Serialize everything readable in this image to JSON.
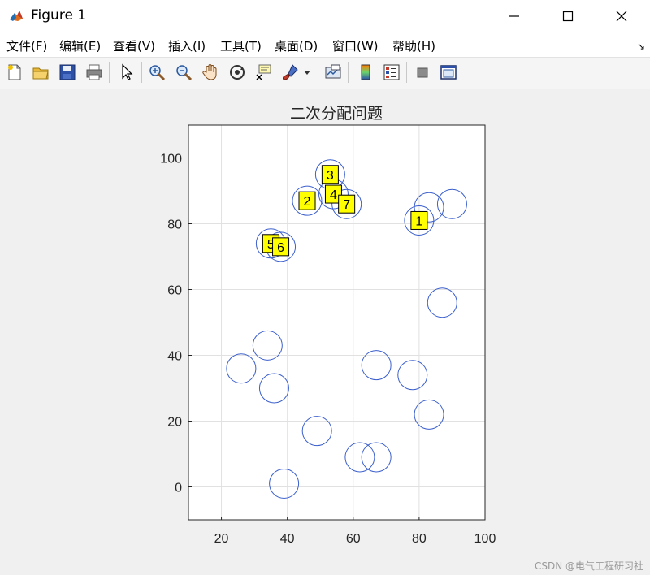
{
  "window": {
    "title": "Figure 1"
  },
  "menu": [
    "文件(F)",
    "编辑(E)",
    "查看(V)",
    "插入(I)",
    "工具(T)",
    "桌面(D)",
    "窗口(W)",
    "帮助(H)"
  ],
  "toolbar_icons": [
    "new-figure-icon",
    "open-file-icon",
    "save-icon",
    "print-icon",
    "pointer-icon",
    "zoom-in-icon",
    "zoom-out-icon",
    "pan-icon",
    "rotate-3d-icon",
    "data-cursor-icon",
    "brush-icon",
    "dropdown-arrow-icon",
    "link-plot-icon",
    "colorbar-icon",
    "legend-icon",
    "hide-plot-tools-icon",
    "show-plot-tools-icon"
  ],
  "chart_data": {
    "type": "scatter",
    "title": "二次分配问题",
    "xlim": [
      10,
      100
    ],
    "ylim": [
      -10,
      110
    ],
    "xticks": [
      20,
      40,
      60,
      80,
      100
    ],
    "yticks": [
      0,
      20,
      40,
      60,
      80,
      100
    ],
    "grid": true,
    "marker": "circle",
    "marker_color": "#3b5fcc",
    "circles": [
      {
        "x": 53,
        "y": 95
      },
      {
        "x": 46,
        "y": 87
      },
      {
        "x": 54,
        "y": 89
      },
      {
        "x": 58,
        "y": 86
      },
      {
        "x": 35,
        "y": 74
      },
      {
        "x": 38,
        "y": 73
      },
      {
        "x": 80,
        "y": 81
      },
      {
        "x": 83,
        "y": 85
      },
      {
        "x": 90,
        "y": 86
      },
      {
        "x": 87,
        "y": 56
      },
      {
        "x": 34,
        "y": 43
      },
      {
        "x": 26,
        "y": 36
      },
      {
        "x": 36,
        "y": 30
      },
      {
        "x": 67,
        "y": 37
      },
      {
        "x": 78,
        "y": 34
      },
      {
        "x": 83,
        "y": 22
      },
      {
        "x": 49,
        "y": 17
      },
      {
        "x": 62,
        "y": 9
      },
      {
        "x": 67,
        "y": 9
      },
      {
        "x": 39,
        "y": 1
      }
    ],
    "labels": [
      {
        "text": "1",
        "x": 80,
        "y": 81
      },
      {
        "text": "2",
        "x": 46,
        "y": 87
      },
      {
        "text": "3",
        "x": 53,
        "y": 95
      },
      {
        "text": "4",
        "x": 54,
        "y": 89
      },
      {
        "text": "7",
        "x": 58,
        "y": 86
      },
      {
        "text": "5",
        "x": 35,
        "y": 74
      },
      {
        "text": "6",
        "x": 38,
        "y": 73
      }
    ],
    "label_style": {
      "background": "#ffff00",
      "border": "#000000"
    }
  },
  "watermark": "CSDN @电气工程研习社"
}
